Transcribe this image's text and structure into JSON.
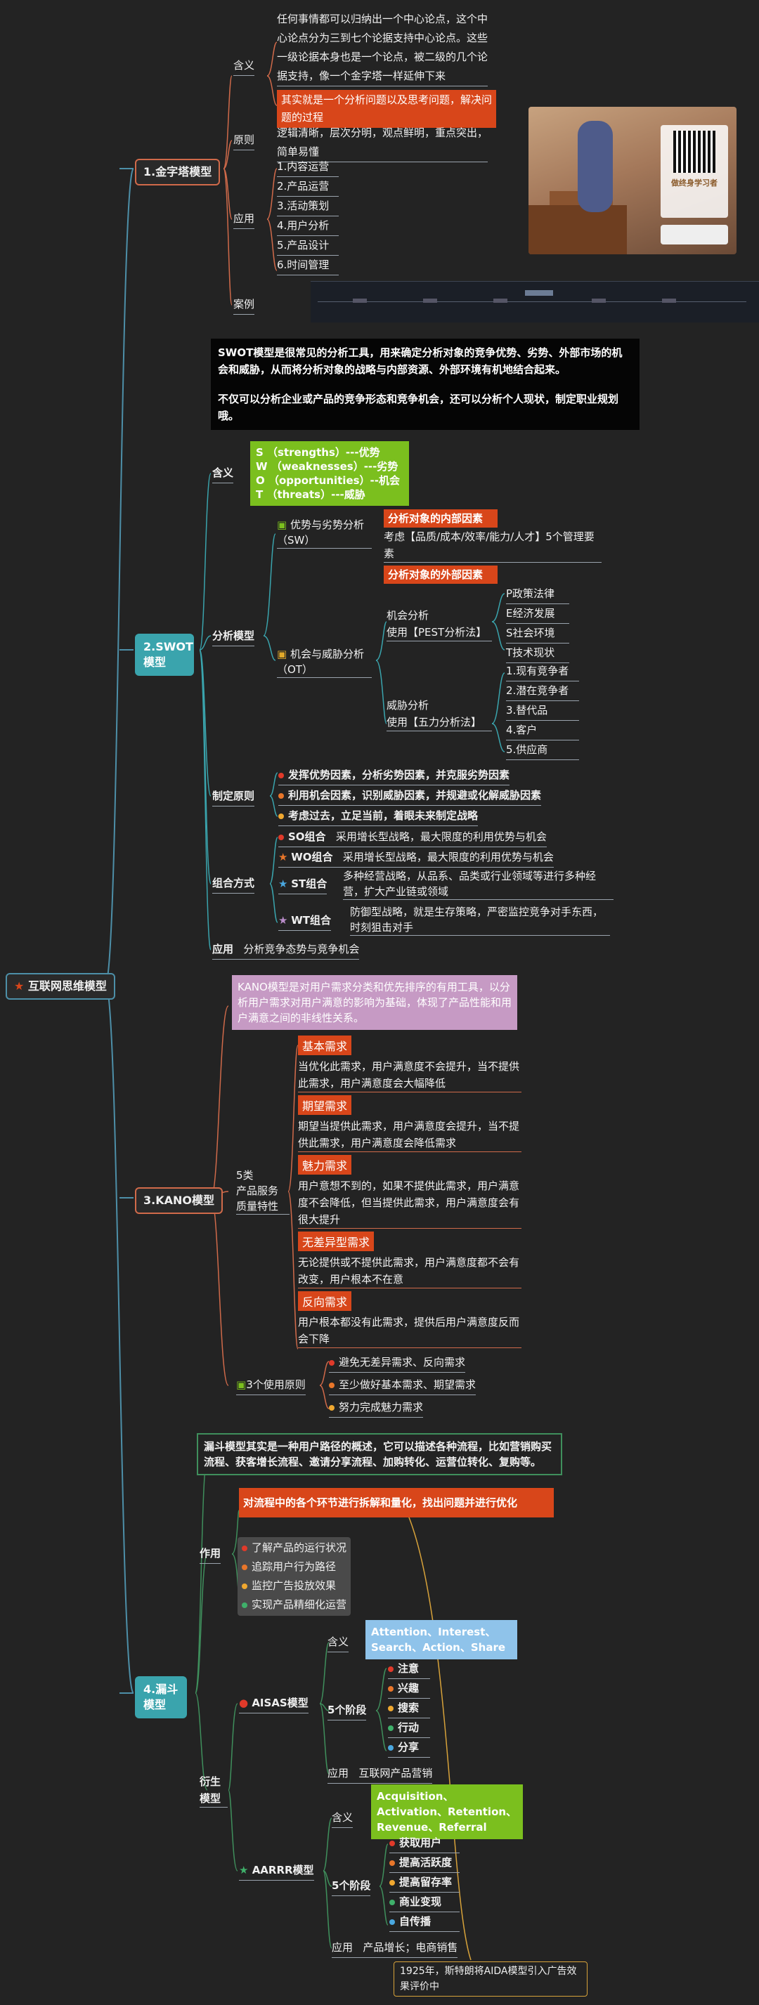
{
  "root": "互联网思维模型",
  "pyramid": {
    "title": "1.金字塔模型",
    "meaning_label": "含义",
    "meaning_text": "任何事情都可以归纳出一个中心论点，这个中心论点分为三到七个论据支持中心论点。这些一级论据本身也是一个论点，被二级的几个论据支持，像一个金字塔一样延伸下来",
    "meaning_highlight": "其实就是一个分析问题以及思考问题，解决问题的过程",
    "principle_label": "原则",
    "principle_text": "逻辑清晰，层次分明，观点鲜明，重点突出，简单易懂",
    "apply_label": "应用",
    "apply_items": [
      "1.内容运营",
      "2.产品运营",
      "3.活动策划",
      "4.用户分析",
      "5.产品设计",
      "6.时间管理"
    ],
    "case_label": "案例",
    "ad_title": "做终身学习者"
  },
  "swot": {
    "title": "2.SWOT模型",
    "intro": "SWOT模型是很常见的分析工具，用来确定分析对象的竞争优势、劣势、外部市场的机会和威胁，从而将分析对象的战略与内部资源、外部环境有机地结合起来。",
    "intro2": "不仅可以分析企业或产品的竞争形态和竞争机会，还可以分析个人现状，制定职业规划哦。",
    "meaning_label": "含义",
    "meaning_lines": [
      "S （strengths）---优势",
      "W （weaknesses）---劣势",
      "O （opportunities）--机会",
      "T （threats）---威胁"
    ],
    "analysis_label": "分析模型",
    "sw_label": "优势与劣势分析（SW）",
    "sw_tag": "分析对象的内部因素",
    "sw_text": "考虑【品质/成本/效率/能力/人才】5个管理要素",
    "ot_label": "机会与威胁分析（OT）",
    "ot_tag": "分析对象的外部因素",
    "opp_label": "机会分析\n使用【PEST分析法】",
    "pest": [
      "P政策法律",
      "E经济发展",
      "S社会环境",
      "T技术现状"
    ],
    "threat_label": "威胁分析\n使用【五力分析法】",
    "five": [
      "1.现有竞争者",
      "2.潜在竞争者",
      "3.替代品",
      "4.客户",
      "5.供应商"
    ],
    "rule_label": "制定原则",
    "rules": [
      "发挥优势因素，分析劣势因素，并克服劣势因素",
      "利用机会因素，识别威胁因素，并规避或化解威胁因素",
      "考虑过去，立足当前，着眼未来制定战略"
    ],
    "combo_label": "组合方式",
    "combos": [
      {
        "name": "SO组合",
        "text": "采用增长型战略，最大限度的利用优势与机会"
      },
      {
        "name": "WO组合",
        "text": "采用增长型战略，最大限度的利用优势与机会"
      },
      {
        "name": "ST组合",
        "text": "多种经营战略，从品系、品类或行业领域等进行多种经营，扩大产业链或领域"
      },
      {
        "name": "WT组合",
        "text": "防御型战略，就是生存策略，严密监控竞争对手东西，时刻狙击对手"
      }
    ],
    "apply_label": "应用",
    "apply_text": "分析竞争态势与竞争机会"
  },
  "kano": {
    "title": "3.KANO模型",
    "intro": "KANO模型是对用户需求分类和优先排序的有用工具，以分析用户需求对用户满意的影响为基础，体现了产品性能和用户满意之间的非线性关系。",
    "five_label": "5类\n产品服务\n质量特性",
    "needs": [
      {
        "tag": "基本需求",
        "text": "当优化此需求，用户满意度不会提升，当不提供此需求，用户满意度会大幅降低"
      },
      {
        "tag": "期望需求",
        "text": "期望当提供此需求，用户满意度会提升，当不提供此需求，用户满意度会降低需求"
      },
      {
        "tag": "魅力需求",
        "text": "用户意想不到的，如果不提供此需求，用户满意度不会降低，但当提供此需求，用户满意度会有很大提升"
      },
      {
        "tag": "无差异型需求",
        "text": "无论提供或不提供此需求，用户满意度都不会有改变，用户根本不在意"
      },
      {
        "tag": "反向需求",
        "text": "用户根本都没有此需求，提供后用户满意度反而会下降"
      }
    ],
    "use_label": "3个使用原则",
    "uses": [
      "避免无差异需求、反向需求",
      "至少做好基本需求、期望需求",
      "努力完成魅力需求"
    ]
  },
  "funnel": {
    "title": "4.漏斗模型",
    "intro": "漏斗模型其实是一种用户路径的概述，它可以描述各种流程，比如营销购买流程、获客增长流程、邀请分享流程、加购转化、运营位转化、复购等。",
    "use_label": "作用",
    "use_highlight": "对流程中的各个环节进行拆解和量化，找出问题并进行优化",
    "uses": [
      "了解产品的运行状况",
      "追踪用户行为路径",
      "监控广告投放效果",
      "实现产品精细化运营"
    ],
    "derive_label": "衍生\n模型",
    "aisas": {
      "name": "AISAS模型",
      "meaning_label": "含义",
      "meaning": "Attention、Interest、Search、Action、Share",
      "stage_label": "5个阶段",
      "stages": [
        "注意",
        "兴趣",
        "搜索",
        "行动",
        "分享"
      ],
      "apply_label": "应用",
      "apply": "互联网产品营销"
    },
    "aarrr": {
      "name": "AARRR模型",
      "meaning_label": "含义",
      "meaning": "Acquisition、Activation、Retention、Revenue、Referral",
      "stage_label": "5个阶段",
      "stages": [
        "获取用户",
        "提高活跃度",
        "提高留存率",
        "商业变现",
        "自传播"
      ],
      "apply_label": "应用",
      "apply": "产品增长；电商销售"
    },
    "note": "1925年，斯特朗将AIDA模型引入广告效果评价中"
  },
  "colors": {
    "accent": "#d8461a",
    "teal": "#3aa4ad",
    "green": "#7bbf1e",
    "blue": "#8fc3ea",
    "lilac": "#c69ac4"
  }
}
